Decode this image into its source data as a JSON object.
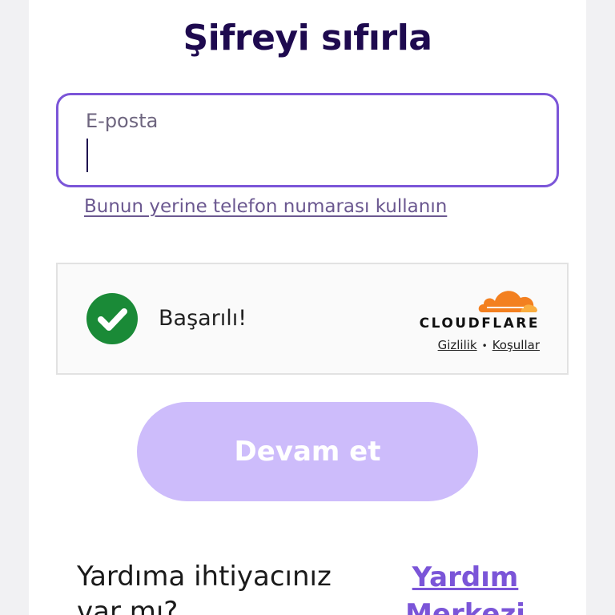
{
  "page": {
    "title": "Şifreyi sıfırla"
  },
  "email": {
    "label": "E-posta",
    "value": "",
    "placeholder": ""
  },
  "phone_link": "Bunun yerine telefon numarası kullanın",
  "captcha": {
    "status": "Başarılı!",
    "brand": "CLOUDFLARE",
    "privacy_label": "Gizlilik",
    "separator": "•",
    "terms_label": "Koşullar",
    "check_color": "#1a8a37",
    "brand_cloud_color": "#f38020"
  },
  "continue_button": {
    "label": "Devam et",
    "color": "#cdbcfb"
  },
  "help": {
    "question": "Yardıma ihtiyacınız var mı?",
    "link_label": "Yardım Merkezi"
  },
  "colors": {
    "accent": "#7b55d8",
    "title": "#1e0a4f"
  }
}
